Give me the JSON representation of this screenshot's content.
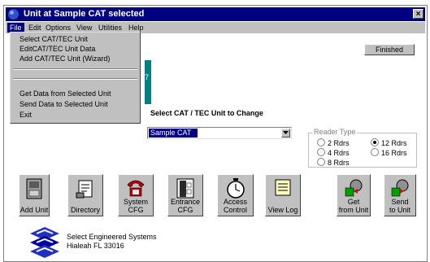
{
  "window": {
    "title": "Unit at Sample CAT selected",
    "close_glyph": "×"
  },
  "menubar": {
    "items": [
      "File",
      "Edit",
      "Options",
      "View",
      "Utilities",
      "Help"
    ]
  },
  "file_menu": {
    "items": [
      "Select CAT/TEC Unit",
      "EditCAT/TEC Unit Data",
      "Add CAT/TEC Unit (Wizard)",
      "Get Data from Selected Unit",
      "Send Data  to  Selected Unit",
      "Exit"
    ]
  },
  "finished_button": "Finished",
  "teal_panel_text": "7",
  "unit_picker": {
    "heading": "Select CAT / TEC Unit to Change",
    "selected_value": "Sample CAT"
  },
  "reader_type": {
    "legend": "Reader Type",
    "options": [
      "2 Rdrs",
      "4 Rdrs",
      "8 Rdrs",
      "12 Rdrs",
      "16 Rdrs"
    ],
    "selected": "12 Rdrs"
  },
  "toolbar": {
    "add_unit": "Add Unit",
    "directory": "Directory",
    "system_cfg_1": "System",
    "system_cfg_2": "CFG",
    "entrance_cfg_1": "Entrance",
    "entrance_cfg_2": "CFG",
    "access_control_1": "Access",
    "access_control_2": "Control",
    "view_log": "View Log",
    "get_from_unit_1": "Get",
    "get_from_unit_2": "from Unit",
    "send_to_unit_1": "Send",
    "send_to_unit_2": "to Unit"
  },
  "company": {
    "line1": "Select Engineered Systems",
    "line2": "Hialeah FL 33016"
  },
  "colors": {
    "titlebar": "#000080",
    "face": "#c0c0c0",
    "teal": "#008080"
  }
}
